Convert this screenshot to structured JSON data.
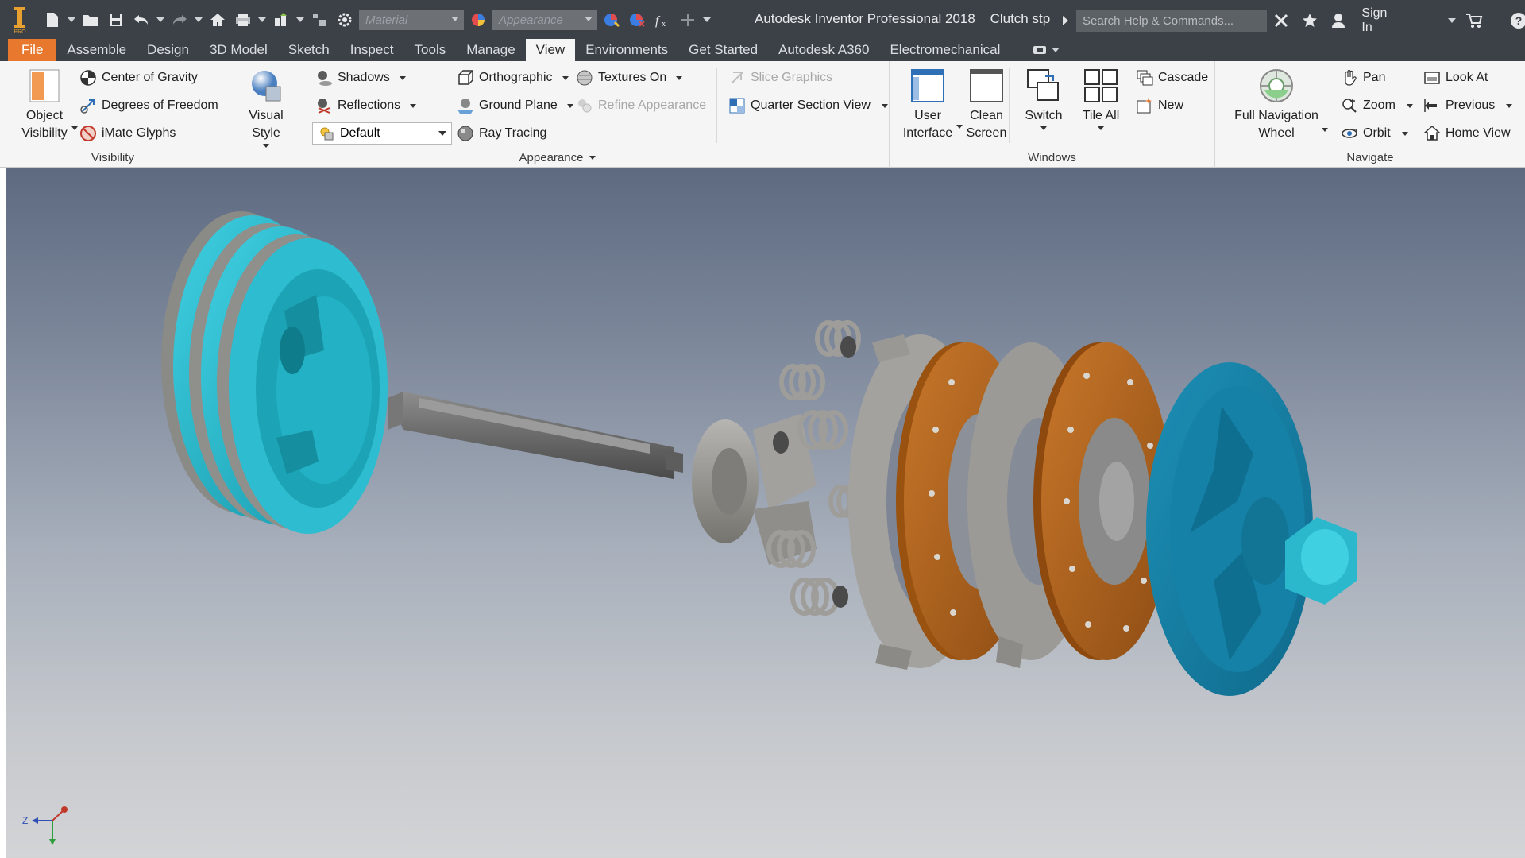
{
  "titlebar": {
    "material_placeholder": "Material",
    "appearance_placeholder": "Appearance",
    "app_title": "Autodesk Inventor Professional 2018",
    "document_title": "Clutch stp",
    "search_placeholder": "Search Help & Commands...",
    "sign_in": "Sign In"
  },
  "tabs": [
    "File",
    "Assemble",
    "Design",
    "3D Model",
    "Sketch",
    "Inspect",
    "Tools",
    "Manage",
    "View",
    "Environments",
    "Get Started",
    "Autodesk A360",
    "Electromechanical"
  ],
  "active_tab": "View",
  "ribbon": {
    "visibility": {
      "label": "Visibility",
      "object_visibility": "Object Visibility",
      "center_of_gravity": "Center of Gravity",
      "degrees_of_freedom": "Degrees of Freedom",
      "imate_glyphs": "iMate Glyphs"
    },
    "appearance": {
      "label": "Appearance",
      "visual_style": "Visual Style",
      "shadows": "Shadows",
      "reflections": "Reflections",
      "default_combo": "Default",
      "orthographic": "Orthographic",
      "ground_plane": "Ground Plane",
      "ray_tracing": "Ray Tracing",
      "textures_on": "Textures On",
      "refine_appearance": "Refine Appearance",
      "slice_graphics": "Slice Graphics",
      "quarter_section_view": "Quarter Section View"
    },
    "windows": {
      "label": "Windows",
      "user_interface": "User Interface",
      "clean_screen": "Clean Screen",
      "switch": "Switch",
      "tile_all": "Tile All",
      "cascade": "Cascade",
      "new": "New"
    },
    "navigate": {
      "label": "Navigate",
      "full_navigation_wheel": "Full Navigation Wheel",
      "pan": "Pan",
      "zoom": "Zoom",
      "orbit": "Orbit",
      "look_at": "Look At",
      "previous": "Previous",
      "home_view": "Home View"
    }
  },
  "viewport": {
    "triad_axes": {
      "z": "Z"
    }
  },
  "colors": {
    "titlebar": "#3c4148",
    "file_tab": "#e8782d",
    "ribbon": "#f5f5f5",
    "teal_part": "#21b3c8",
    "friction_disc": "#b0621c",
    "steel_part": "#9a9894"
  }
}
